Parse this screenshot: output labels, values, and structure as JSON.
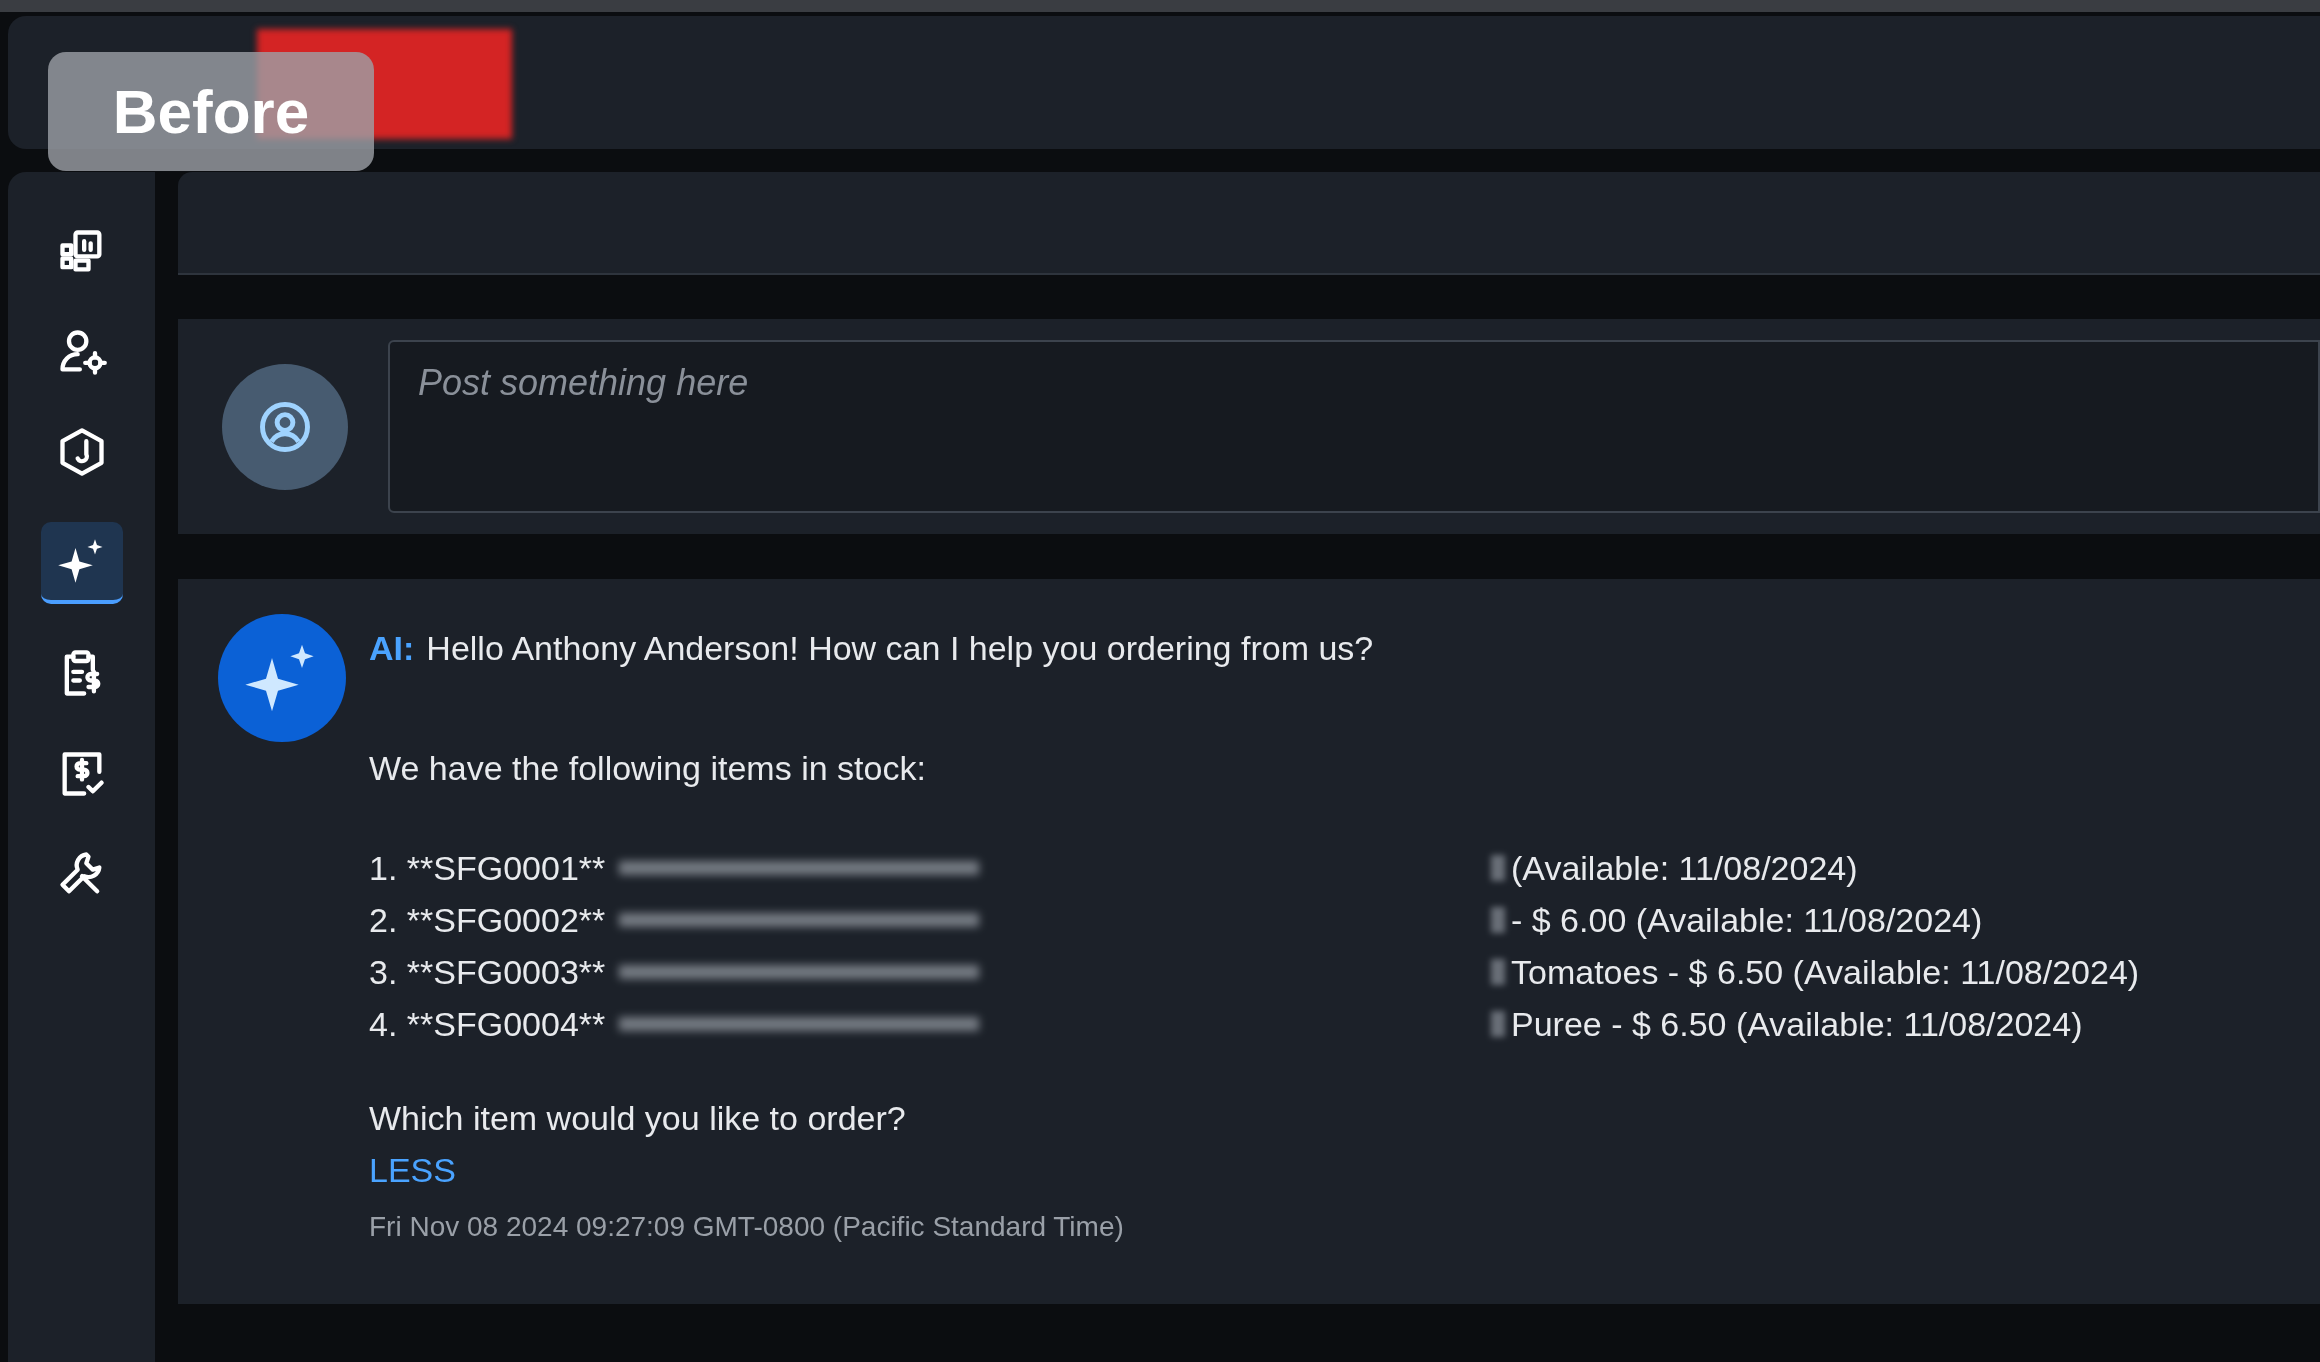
{
  "overlay_badge": {
    "label": "Before"
  },
  "sidebar": {
    "items": [
      {
        "selected": false
      },
      {
        "selected": false
      },
      {
        "selected": false
      },
      {
        "selected": true
      },
      {
        "selected": false
      },
      {
        "selected": false
      },
      {
        "selected": false
      }
    ]
  },
  "composer": {
    "placeholder": "Post something here"
  },
  "message": {
    "sender": "AI:",
    "greeting": "Hello Anthony Anderson! How can I help you ordering from us?",
    "intro": "We have the following items in stock:",
    "items": [
      {
        "code": "1. **SFG0001**",
        "detail": "(Available: 11/08/2024)"
      },
      {
        "code": "2. **SFG0002**",
        "detail": "- $ 6.00 (Available: 11/08/2024)"
      },
      {
        "code": "3. **SFG0003**",
        "detail": "Tomatoes - $ 6.50 (Available: 11/08/2024)"
      },
      {
        "code": "4. **SFG0004**",
        "detail": "Puree - $ 6.50 (Available: 11/08/2024)"
      }
    ],
    "question": "Which item would you like to order?",
    "toggle": "LESS",
    "timestamp": "Fri Nov 08 2024 09:27:09 GMT-0800 (Pacific Standard Time)"
  }
}
